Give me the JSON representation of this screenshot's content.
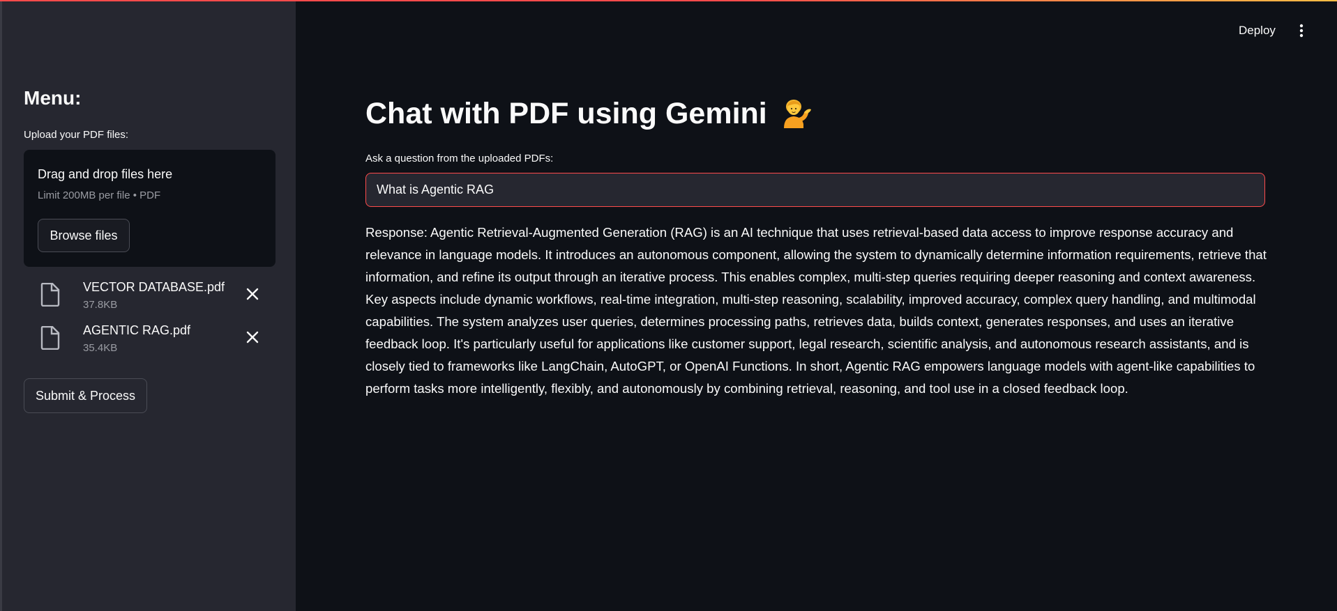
{
  "header": {
    "deploy_label": "Deploy",
    "more_icon": "kebab-menu-icon"
  },
  "sidebar": {
    "heading": "Menu:",
    "upload_label": "Upload your PDF files:",
    "dropzone": {
      "title": "Drag and drop files here",
      "limit": "Limit 200MB per file • PDF",
      "browse_label": "Browse files"
    },
    "files": [
      {
        "name": "VECTOR DATABASE.pdf",
        "size": "37.8KB",
        "icon": "file-icon"
      },
      {
        "name": "AGENTIC RAG.pdf",
        "size": "35.4KB",
        "icon": "file-icon"
      }
    ],
    "submit_label": "Submit & Process"
  },
  "main": {
    "title": "Chat with PDF using Gemini",
    "title_emoji": "person-tipping-hand-emoji",
    "question_label": "Ask a question from the uploaded PDFs:",
    "question_value": "What is Agentic RAG",
    "response": "Response: Agentic Retrieval-Augmented Generation (RAG) is an AI technique that uses retrieval-based data access to improve response accuracy and relevance in language models. It introduces an autonomous component, allowing the system to dynamically determine information requirements, retrieve that information, and refine its output through an iterative process. This enables complex, multi-step queries requiring deeper reasoning and context awareness. Key aspects include dynamic workflows, real-time integration, multi-step reasoning, scalability, improved accuracy, complex query handling, and multimodal capabilities. The system analyzes user queries, determines processing paths, retrieves data, builds context, generates responses, and uses an iterative feedback loop. It's particularly useful for applications like customer support, legal research, scientific analysis, and autonomous research assistants, and is closely tied to frameworks like LangChain, AutoGPT, or OpenAI Functions. In short, Agentic RAG empowers language models with agent-like capabilities to perform tasks more intelligently, flexibly, and autonomously by combining retrieval, reasoning, and tool use in a closed feedback loop."
  },
  "colors": {
    "background": "#0e1117",
    "sidebar": "#262730",
    "accent": "#ff4b4b",
    "text": "#fafafa",
    "muted": "#9a9ca3"
  }
}
